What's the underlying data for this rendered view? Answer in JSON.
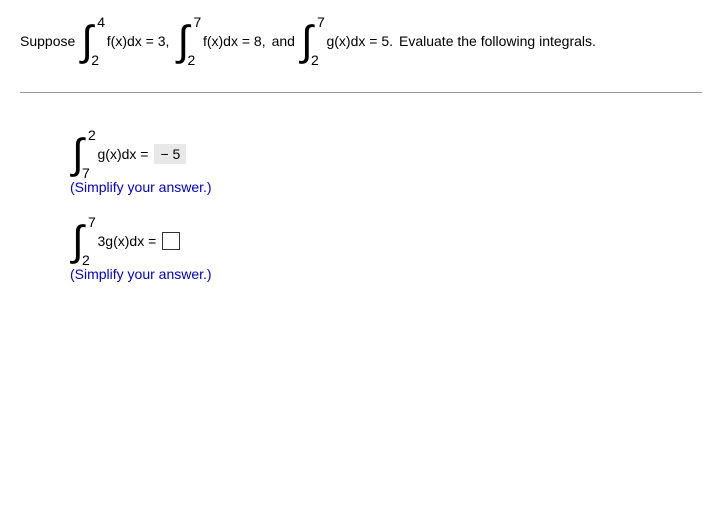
{
  "statement": {
    "suppose": "Suppose",
    "int1": {
      "upper": "4",
      "lower": "2",
      "body": "f(x)dx = 3,"
    },
    "int2": {
      "upper": "7",
      "lower": "2",
      "body": "f(x)dx = 8,"
    },
    "and": "and",
    "int3": {
      "upper": "7",
      "lower": "2",
      "body": "g(x)dx = 5."
    },
    "tail": "Evaluate the following integrals."
  },
  "q1": {
    "upper": "2",
    "lower": "7",
    "body": "g(x)dx =",
    "answer": "− 5",
    "simplify": "(Simplify your answer.)"
  },
  "q2": {
    "upper": "7",
    "lower": "2",
    "body": "3g(x)dx =",
    "simplify": "(Simplify your answer.)"
  }
}
